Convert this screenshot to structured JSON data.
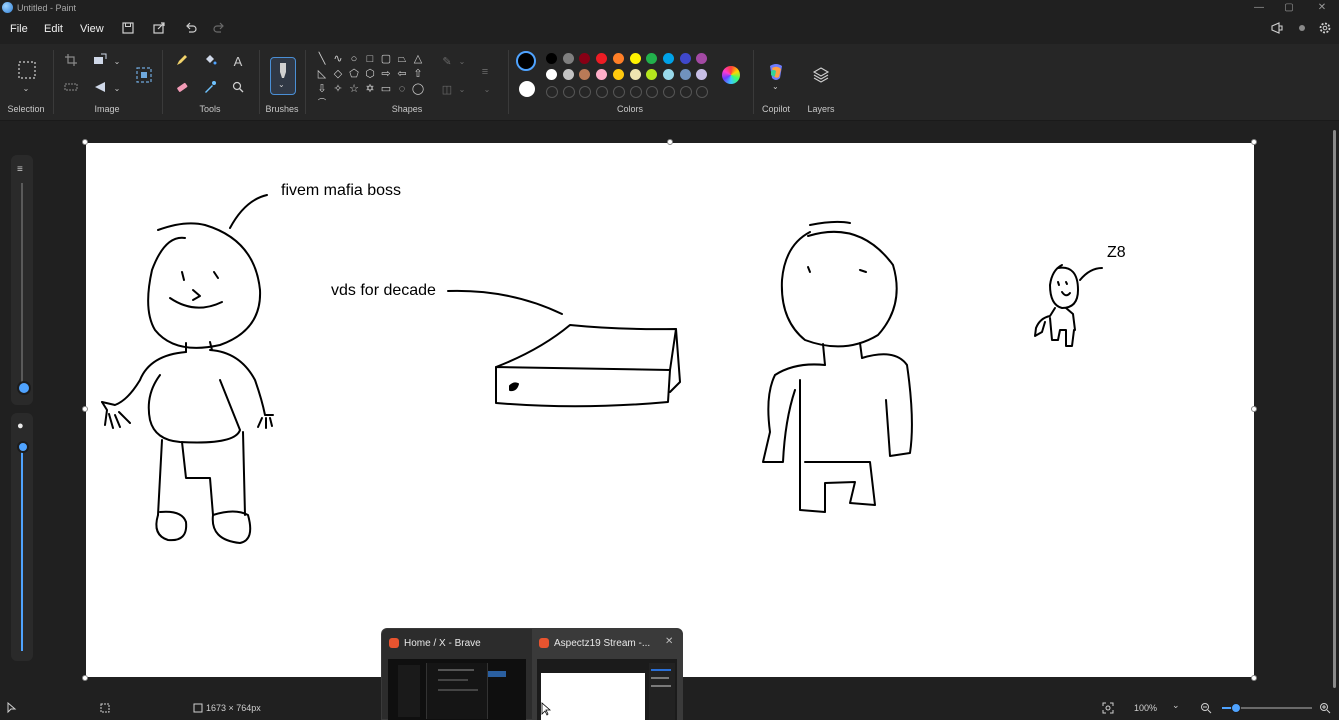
{
  "window": {
    "title": "Untitled - Paint",
    "controls": {
      "minimize": "—",
      "maximize": "▢",
      "close": "✕"
    }
  },
  "menu": {
    "items": [
      "File",
      "Edit",
      "View"
    ]
  },
  "toolbar": {
    "save_icon": "save-icon",
    "share_icon": "share-icon",
    "undo_icon": "undo-icon",
    "redo_icon": "redo-icon"
  },
  "ribbon": {
    "groups": {
      "selection": "Selection",
      "image": "Image",
      "tools": "Tools",
      "brushes": "Brushes",
      "shapes": "Shapes",
      "colors": "Colors",
      "copilot": "Copilot",
      "layers": "Layers"
    },
    "palette_row1": [
      "#000000",
      "#7f7f7f",
      "#880015",
      "#ed1c24",
      "#ff7f27",
      "#fff200",
      "#22b14c",
      "#00a2e8",
      "#3f48cc",
      "#a349a4"
    ],
    "palette_row2": [
      "#ffffff",
      "#c3c3c3",
      "#b97a57",
      "#ffaec9",
      "#ffc90e",
      "#efe4b0",
      "#b5e61d",
      "#99d9ea",
      "#7092be",
      "#c8bfe7"
    ],
    "primary_color": "#000000",
    "secondary_color": "#ffffff"
  },
  "canvas": {
    "annotations": {
      "boss": "fivem mafia boss",
      "vds": "vds for decade",
      "z8": "Z8"
    }
  },
  "status": {
    "canvas_size": "1673 × 764px",
    "zoom": "100%"
  },
  "taskbar_preview": {
    "windows": [
      {
        "title": "Home / X - Brave"
      },
      {
        "title": "Aspectz19 Stream -..."
      }
    ]
  }
}
